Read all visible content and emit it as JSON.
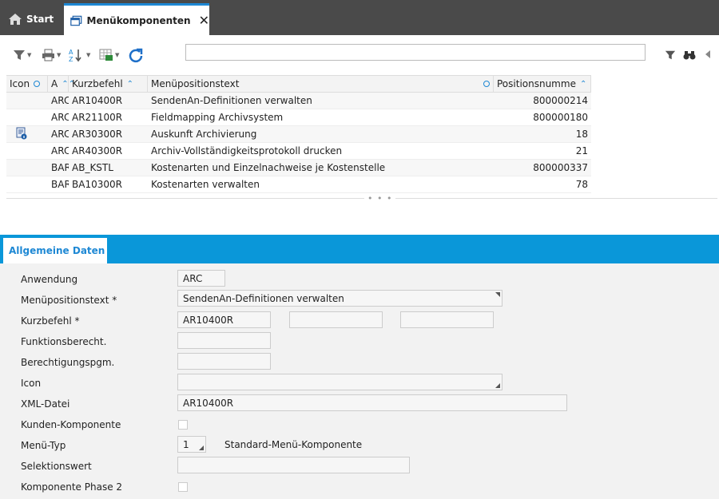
{
  "tabs": {
    "start_label": "Start",
    "active_label": "Menükomponenten"
  },
  "toolbar": {
    "icons": [
      "filter-icon",
      "print-icon",
      "sort-az-icon",
      "export-excel-icon",
      "refresh-icon"
    ],
    "search_value": "",
    "right_icons": [
      "filter-icon",
      "binoculars-icon",
      "arrow-left-icon"
    ]
  },
  "grid": {
    "headers": {
      "icon": "Icon",
      "a": "A",
      "kurzbefehl": "Kurzbefehl",
      "text": "Menüpositionstext",
      "pos": "Positionsnumme"
    },
    "rows": [
      {
        "icon": "",
        "a": "ARC",
        "kurz": "AR10400R",
        "text": "SendenAn-Definitionen verwalten",
        "pos": "800000214"
      },
      {
        "icon": "",
        "a": "ARC",
        "kurz": "AR21100R",
        "text": "Fieldmapping Archivsystem",
        "pos": "800000180"
      },
      {
        "icon": "info-document-icon",
        "a": "ARC",
        "kurz": "AR30300R",
        "text": "Auskunft Archivierung",
        "pos": "18"
      },
      {
        "icon": "",
        "a": "ARC",
        "kurz": "AR40300R",
        "text": "Archiv-Vollständigkeitsprotokoll drucken",
        "pos": "21"
      },
      {
        "icon": "",
        "a": "BAR",
        "kurz": "AB_KSTL",
        "text": "Kostenarten und Einzelnachweise je Kostenstelle",
        "pos": "800000337"
      },
      {
        "icon": "",
        "a": "BAR",
        "kurz": "BA10300R",
        "text": "Kostenarten verwalten",
        "pos": "78"
      }
    ]
  },
  "splitter_dots": "• • •",
  "details": {
    "tab_label": "Allgemeine Daten",
    "labels": {
      "anwendung": "Anwendung",
      "menutext": "Menüpositionstext *",
      "kurzbefehl": "Kurzbefehl *",
      "funktion": "Funktionsberecht.",
      "berechtigung": "Berechtigungspgm.",
      "icon": "Icon",
      "xml": "XML-Datei",
      "kunden": "Kunden-Komponente",
      "menutyp": "Menü-Typ",
      "selektion": "Selektionswert",
      "phase2": "Komponente Phase 2"
    },
    "values": {
      "anwendung": "ARC",
      "menutext": "SendenAn-Definitionen verwalten",
      "kurzbefehl": "AR10400R",
      "kurzbefehl2": "",
      "kurzbefehl3": "",
      "funktion": "",
      "berechtigung": "",
      "icon": "",
      "xml": "AR10400R",
      "menutyp": "1",
      "menutyp_text": "Standard-Menü-Komponente",
      "selektion": ""
    }
  }
}
